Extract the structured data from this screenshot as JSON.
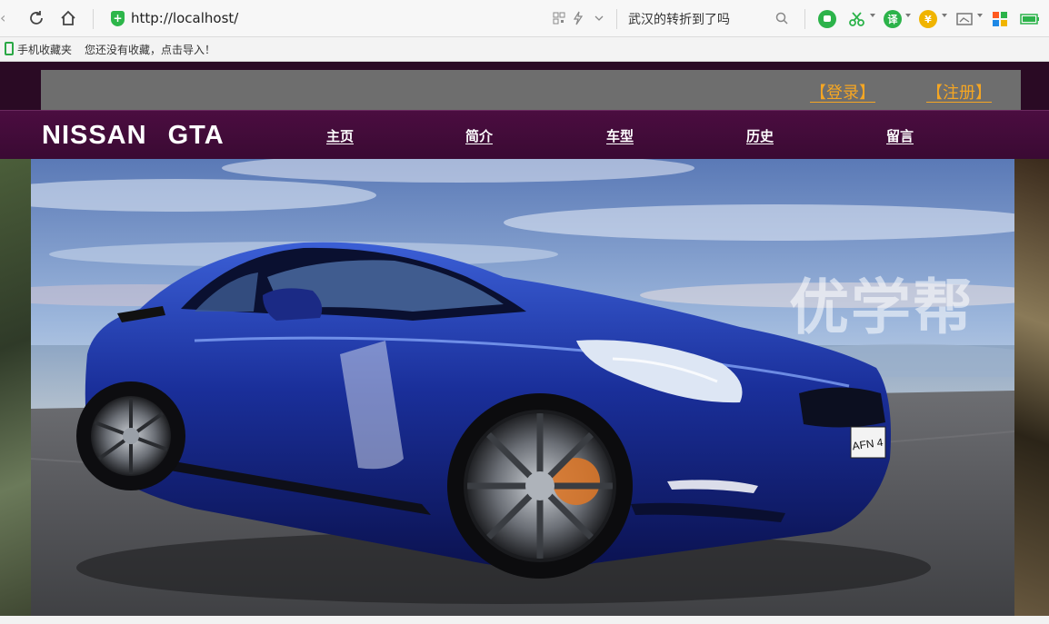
{
  "browser": {
    "url": "http://localhost/",
    "search_text": "武汉的转折到了吗",
    "favorites_label": "手机收藏夹",
    "favorites_empty_text": "您还没有收藏，点击导入！"
  },
  "site": {
    "logo": "NISSAN GTA",
    "auth": {
      "login": "【登录】",
      "register": "【注册】"
    },
    "nav": [
      "主页",
      "简介",
      "车型",
      "历史",
      "留言"
    ],
    "banner": {
      "watermark": "优学帮",
      "car_plate": "AFN 4"
    }
  },
  "colors": {
    "accent": "#f5a623",
    "navbar": "#4b0d40",
    "page_bg": "#2a0a24",
    "topstrip": "#6e6e6e"
  }
}
